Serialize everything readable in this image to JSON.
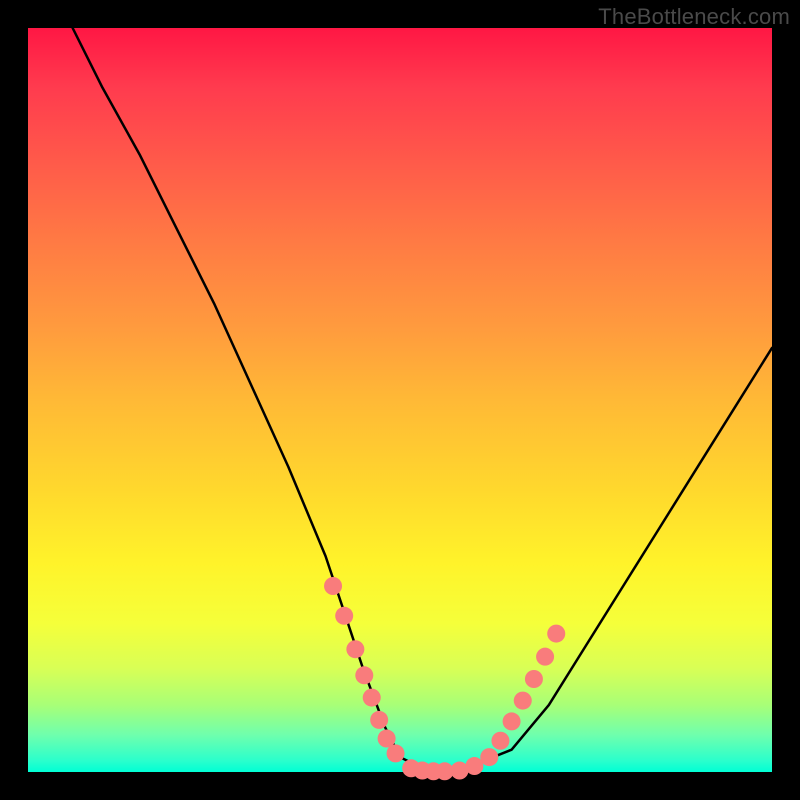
{
  "watermark": "TheBottleneck.com",
  "chart_data": {
    "type": "line",
    "title": "",
    "xlabel": "",
    "ylabel": "",
    "xlim": [
      0,
      100
    ],
    "ylim": [
      0,
      100
    ],
    "grid": false,
    "series": [
      {
        "name": "curve",
        "color": "#000000",
        "x": [
          6,
          10,
          15,
          20,
          25,
          30,
          35,
          40,
          45,
          48,
          50,
          52,
          55,
          58,
          60,
          65,
          70,
          75,
          80,
          85,
          90,
          95,
          100
        ],
        "y": [
          100,
          92,
          83,
          73,
          63,
          52,
          41,
          29,
          14,
          6,
          2,
          1,
          0,
          0,
          1,
          3,
          9,
          17,
          25,
          33,
          41,
          49,
          57
        ]
      }
    ],
    "markers": [
      {
        "name": "left-dots",
        "color": "#f97c7c",
        "points": [
          {
            "x": 41,
            "y": 25
          },
          {
            "x": 42.5,
            "y": 21
          },
          {
            "x": 44,
            "y": 16.5
          },
          {
            "x": 45.2,
            "y": 13
          },
          {
            "x": 46.2,
            "y": 10
          },
          {
            "x": 47.2,
            "y": 7
          },
          {
            "x": 48.2,
            "y": 4.5
          },
          {
            "x": 49.4,
            "y": 2.5
          }
        ]
      },
      {
        "name": "bottom-dots",
        "color": "#f97c7c",
        "points": [
          {
            "x": 51.5,
            "y": 0.5
          },
          {
            "x": 53,
            "y": 0.2
          },
          {
            "x": 54.5,
            "y": 0.1
          },
          {
            "x": 56,
            "y": 0.1
          },
          {
            "x": 58,
            "y": 0.2
          },
          {
            "x": 60,
            "y": 0.8
          }
        ]
      },
      {
        "name": "right-dots",
        "color": "#f97c7c",
        "points": [
          {
            "x": 62,
            "y": 2
          },
          {
            "x": 63.5,
            "y": 4.2
          },
          {
            "x": 65,
            "y": 6.8
          },
          {
            "x": 66.5,
            "y": 9.6
          },
          {
            "x": 68,
            "y": 12.5
          },
          {
            "x": 69.5,
            "y": 15.5
          },
          {
            "x": 71,
            "y": 18.6
          }
        ]
      }
    ],
    "background_gradient_note": "vertical red-to-green heat gradient"
  }
}
